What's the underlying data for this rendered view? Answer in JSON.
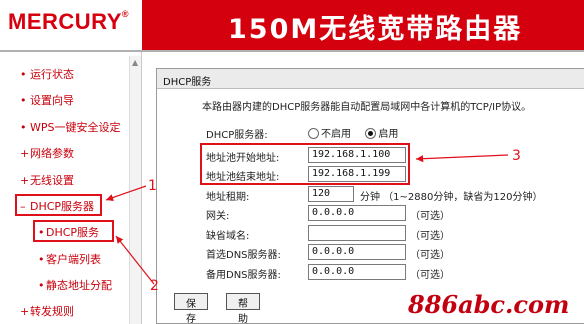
{
  "header": {
    "logo": "MERCURY",
    "logo_reg": "®",
    "title": "150M无线宽带路由器"
  },
  "sidebar": {
    "items": [
      {
        "label": "运行状态",
        "bullet": "•"
      },
      {
        "label": "设置向导",
        "bullet": "•"
      },
      {
        "label": "WPS一键安全设定",
        "bullet": "•"
      },
      {
        "label": "网络参数",
        "bullet": "+"
      },
      {
        "label": "无线设置",
        "bullet": "+"
      },
      {
        "label": "DHCP服务器",
        "bullet": "–"
      },
      {
        "label": "转发规则",
        "bullet": "+"
      }
    ],
    "subitems": [
      {
        "label": "DHCP服务",
        "bullet": "•"
      },
      {
        "label": "客户端列表",
        "bullet": "•"
      },
      {
        "label": "静态地址分配",
        "bullet": "•"
      }
    ]
  },
  "panel": {
    "title": "DHCP服务",
    "description": "本路由器内建的DHCP服务器能自动配置局域网中各计算机的TCP/IP协议。",
    "server_label": "DHCP服务器:",
    "radio_off": "不启用",
    "radio_on": "启用",
    "selected": "启用",
    "fields": [
      {
        "label": "地址池开始地址:",
        "value": "192.168.1.100"
      },
      {
        "label": "地址池结束地址:",
        "value": "192.168.1.199"
      },
      {
        "label": "地址租期:",
        "value": "120",
        "hint": "分钟 （1~2880分钟，缺省为120分钟）"
      },
      {
        "label": "网关:",
        "value": "0.0.0.0",
        "hint": "（可选）"
      },
      {
        "label": "缺省域名:",
        "value": "",
        "hint": "（可选）"
      },
      {
        "label": "首选DNS服务器:",
        "value": "0.0.0.0",
        "hint": "（可选）"
      },
      {
        "label": "备用DNS服务器:",
        "value": "0.0.0.0",
        "hint": "（可选）"
      }
    ]
  },
  "buttons": {
    "save": "保 存",
    "help": "帮 助"
  },
  "annotations": {
    "n1": "1",
    "n2": "2",
    "n3": "3",
    "color": "#e0101a"
  },
  "watermark": "886abc.com"
}
